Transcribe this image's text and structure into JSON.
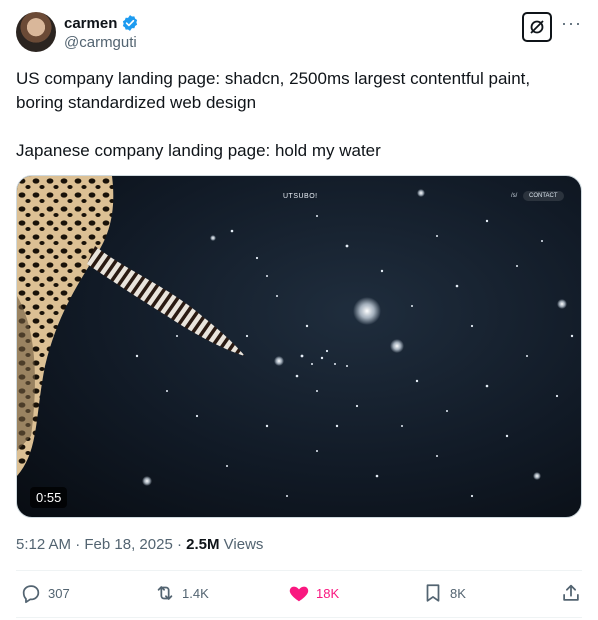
{
  "author": {
    "display_name": "carmen",
    "handle": "@carmguti",
    "verified": true
  },
  "tweet": {
    "paragraphs": [
      "US company landing page: shadcn, 2500ms largest contentful paint, boring standardized web design",
      "Japanese company landing page: hold my water"
    ]
  },
  "media": {
    "site_title": "UTSUBO!",
    "site_nav": "/s/",
    "site_contact": "CONTACT",
    "duration": "0:55"
  },
  "meta": {
    "time": "5:12 AM",
    "date": "Feb 18, 2025",
    "views_count": "2.5M",
    "views_label": "Views"
  },
  "actions": {
    "replies": "307",
    "reposts": "1.4K",
    "likes": "18K",
    "bookmarks": "8K"
  },
  "colors": {
    "verified_blue": "#1d9bf0",
    "like_pink": "#f91880",
    "muted_text": "#536471"
  }
}
